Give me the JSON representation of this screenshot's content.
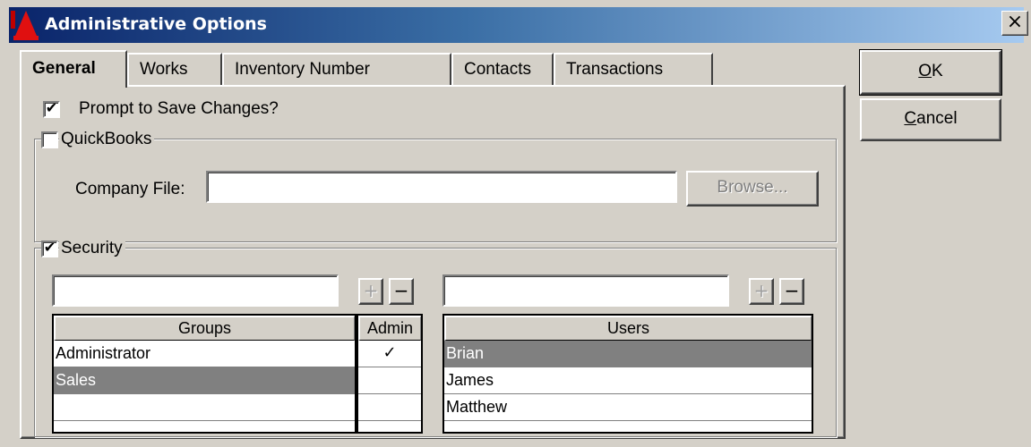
{
  "window": {
    "title": "Administrative Options",
    "close_label": "×"
  },
  "tabs": [
    {
      "label": "General",
      "active": true
    },
    {
      "label": "Works"
    },
    {
      "label": "Inventory Number"
    },
    {
      "label": "Contacts"
    },
    {
      "label": "Transactions"
    }
  ],
  "buttons": {
    "ok_accel": "O",
    "ok_rest": "K",
    "cancel_accel": "C",
    "cancel_rest": "ancel"
  },
  "general": {
    "prompt_save_label": "Prompt to Save Changes?",
    "prompt_save_checked": true
  },
  "quickbooks": {
    "legend": "QuickBooks",
    "enabled": false,
    "company_file_label": "Company File:",
    "company_file_value": "",
    "browse_label": "Browse..."
  },
  "security": {
    "legend": "Security",
    "enabled": true,
    "group_input_value": "",
    "user_input_value": "",
    "plus_label": "+",
    "minus_label": "−",
    "groups_header": "Groups",
    "admin_header": "Admin",
    "users_header": "Users",
    "groups": [
      {
        "name": "Administrator",
        "admin": "✓"
      },
      {
        "name": "Sales",
        "admin": ""
      }
    ],
    "users": [
      "Brian",
      "James",
      "Matthew"
    ]
  },
  "icons": {
    "app": "red-bell-icon",
    "checkmark": "✔"
  }
}
